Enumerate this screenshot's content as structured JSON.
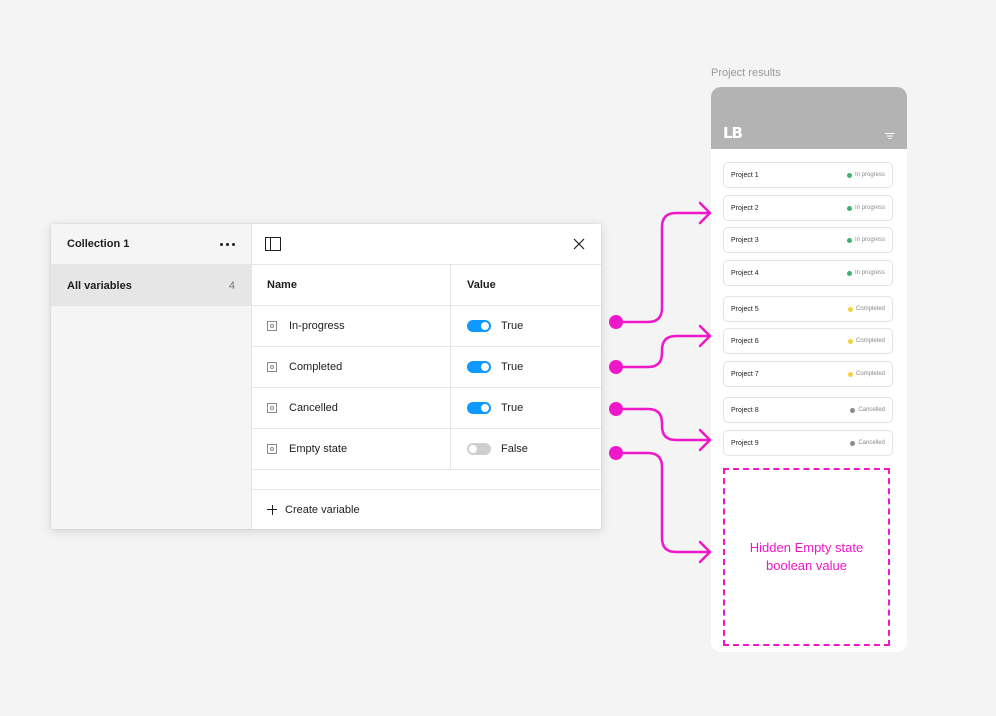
{
  "panel": {
    "collection_name": "Collection 1",
    "sidebar_item_label": "All variables",
    "sidebar_item_count": "4",
    "headers": {
      "name": "Name",
      "value": "Value"
    },
    "variables": [
      {
        "name": "In-progress",
        "value": "True",
        "on": true
      },
      {
        "name": "Completed",
        "value": "True",
        "on": true
      },
      {
        "name": "Cancelled",
        "value": "True",
        "on": true
      },
      {
        "name": "Empty state",
        "value": "False",
        "on": false
      }
    ],
    "create_label": "Create variable"
  },
  "mockup": {
    "label": "Project results",
    "logo": "LB",
    "projects": [
      {
        "name": "Project 1",
        "status": "In progress"
      },
      {
        "name": "Project 2",
        "status": "In progress"
      },
      {
        "name": "Project 3",
        "status": "In progress"
      },
      {
        "name": "Project 4",
        "status": "In progress"
      },
      {
        "name": "Project 5",
        "status": "Completed"
      },
      {
        "name": "Project 6",
        "status": "Completed"
      },
      {
        "name": "Project 7",
        "status": "Completed"
      },
      {
        "name": "Project 8",
        "status": "Cancelled"
      },
      {
        "name": "Project 9",
        "status": "Cancelled"
      }
    ],
    "empty_text_line1": "Hidden Empty state",
    "empty_text_line2": "boolean value"
  },
  "colors": {
    "accent": "#0d99ff",
    "annotation": "#ee17c9",
    "in_progress": "#3cb371",
    "completed": "#f5d142",
    "cancelled": "#8a8a8a"
  }
}
